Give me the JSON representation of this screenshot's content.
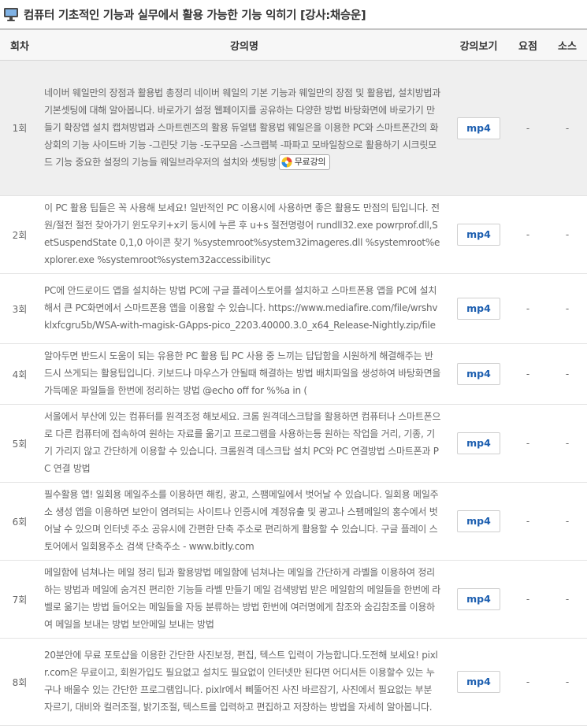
{
  "page": {
    "title": "컴퓨터 기초적인 기능과 실무에서 활용 가능한 기능 익히기 [강사:채승운]",
    "title_icon": "monitor-icon"
  },
  "table": {
    "headers": {
      "round": "회차",
      "lecture_name": "강의명",
      "watch": "강의보기",
      "summary": "요점",
      "source": "소스"
    },
    "rows": [
      {
        "round": "1회",
        "description": "네이버 웨일만의 장점과 활용법 총정리 네이버 웨일의 기본 기능과 웨일만의 장점 및 활용법, 설치방법과 기본셋팅에 대해 알아봅니다. 바로가기 설정 웹페이지를 공유하는 다양한 방법 바탕화면에 바로가기 만들기 확장앱 설치 캡쳐방법과 스마트렌즈의 활용 듀얼탭 활용법 웨일은을 이용한 PC와 스마트폰간의 화상회의 기능 사이드바 기능 -그린닷 기능 -도구모음 -스크랩북 -파파고 모바일창으로 활용하기 시크릿모드 기능 중요한 설정의 기능들 웨일브라우저의 설치와 셋팅방",
        "badge": "무료강의",
        "watch": "mp4",
        "summary": "-",
        "source": "-",
        "highlighted": true
      },
      {
        "round": "2회",
        "description": "이 PC 활용 팁들은 꼭 사용해 보세요! 일반적인 PC 이용시에 사용하면 좋은 활용도 만점의 팁입니다. 전원/절전 절전 찾아가기 윈도우키+x키 동시에 누른 후 u+s 절전명령어 rundll32.exe powrprof.dll,SetSuspendState 0,1,0 아이콘 찾기 %systemroot%system32imageres.dll %systemroot%explorer.exe %systemroot%system32accessibilityc",
        "watch": "mp4",
        "summary": "-",
        "source": "-",
        "highlighted": false
      },
      {
        "round": "3회",
        "description": "PC에 안드로이드 앱을 설치하는 방법 PC에 구글 플레이스토어를 설치하고 스마트폰용 앱을 PC에 설치해서 큰 PC화면에서 스마트폰용 앱을 이용할 수 있습니다. https://www.mediafire.com/file/wrshvklxfcgru5b/WSA-with-magisk-GApps-pico_2203.40000.3.0_x64_Release-Nightly.zip/file",
        "watch": "mp4",
        "summary": "-",
        "source": "-",
        "highlighted": false
      },
      {
        "round": "4회",
        "description": "알아두면 반드시 도움이 되는 유용한 PC 활용 팁 PC 사용 중 느끼는 답답함을 시원하게 해결해주는 반드시 쓰게되는 활용팁입니다. 키보드나 마우스가 안될때 해결하는 방법 배치파일을 생성하여 바탕화면을 가득메운 파일들을 한번에 정리하는 방법 @echo off for %%a in (",
        "watch": "mp4",
        "summary": "-",
        "source": "-",
        "highlighted": false
      },
      {
        "round": "5회",
        "description": "서울에서 부산에 있는 컴퓨터를 원격조정 해보세요. 크롬 원격데스크탑을 활용하면 컴퓨터나 스마트폰으로 다른 컴퓨터에 접속하여 원하는 자료를 옮기고 프로그램을 사용하는등 원하는 작업을 거리, 기종, 기기 가리지 않고 간단하게 이용할 수 있습니다. 크롬원격 데스크탑 설치 PC와 PC 연결방법 스마트폰과 PC 연결 방법",
        "watch": "mp4",
        "summary": "-",
        "source": "-",
        "highlighted": false
      },
      {
        "round": "6회",
        "description": "필수활용 앱! 일회용 메일주소를 이용하면 해킹, 광고, 스팸메일에서 벗어날 수 있습니다. 일회용 메일주소 생성 앱을 이용하면 보안이 염려되는 사이트나 인증시에 계정유출 및 광고나 스팸메일의 홍수에서 벗어날 수 있으며 인터넷 주소 공유시에 간편한 단축 주소로 편리하게 활용할 수 있습니다. 구글 플레이 스토어에서 일회용주소 검색 단축주소 - www.bitly.com",
        "watch": "mp4",
        "summary": "-",
        "source": "-",
        "highlighted": false
      },
      {
        "round": "7회",
        "description": "메일함에 넘쳐나는 메일 정리 팁과 활용방법 메일함에 넘쳐나는 메일을 간단하게 라벨을 이용하여 정리하는 방법과 메일에 숨겨진 편리한 기능들 라벨 만들기 메일 검색방법 받은 메일함의 메일들을 한번에 라벨로 옮기는 방법 들어오는 메일들을 자동 분류하는 방법 한번에 여러명에게 참조와 숨김참조를 이용하여 메일을 보내는 방법 보안메일 보내는 방법",
        "watch": "mp4",
        "summary": "-",
        "source": "-",
        "highlighted": false
      },
      {
        "round": "8회",
        "description": "20분안에 무료 포토샵을 이용한 간단한 사진보정, 편집, 텍스트 입력이 가능합니다.도전해 보세요! pixlr.com은 무료이고, 회원가입도 필요없고 설치도 필요없이 인터넷만 된다면 어디서든 이용할수 있는 누구나 배울수 있는 간단한 프로그램입니다. pixlr에서 삐뚤어진 사진 바르잡기, 사진에서 필요없는 부분 자르기, 대비와 컬러조절, 밝기조절, 텍스트를 입력하고 편집하고 저장하는 방법을 자세히 알아봅니다.",
        "watch": "mp4",
        "summary": "-",
        "source": "-",
        "highlighted": false
      }
    ]
  }
}
